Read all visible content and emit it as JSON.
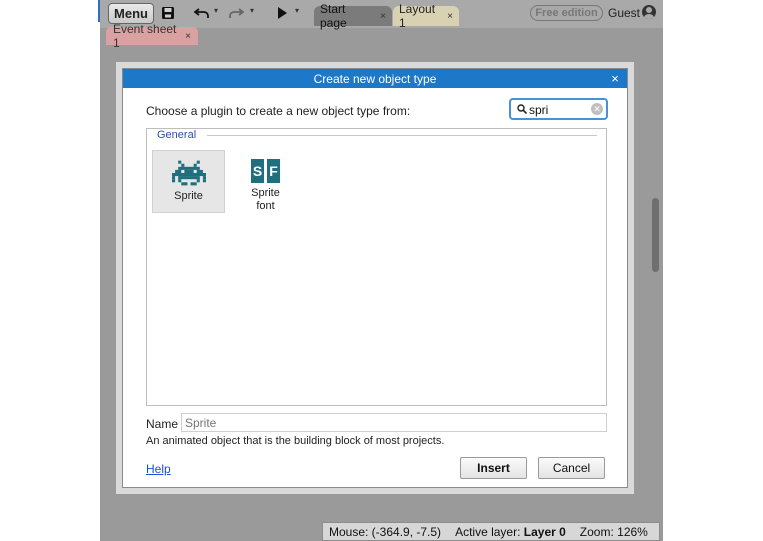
{
  "toolbar": {
    "menu_label": "Menu",
    "tabs": [
      {
        "label": "Start page",
        "close": "×"
      },
      {
        "label": "Layout 1",
        "close": "×"
      }
    ],
    "edition_badge": "Free edition",
    "user_label": "Guest"
  },
  "sheet_tab": {
    "label": "Event sheet 1",
    "close": "×"
  },
  "dialog": {
    "title": "Create new object type",
    "close": "×",
    "prompt": "Choose a plugin to create a new object type from:",
    "search": {
      "value": "spri"
    },
    "group": "General",
    "plugins": [
      {
        "label": "Sprite",
        "icon": "space-invader-icon",
        "selected": true
      },
      {
        "label": "Sprite font",
        "icon": "sprite-font-icon",
        "selected": false
      }
    ],
    "name_label": "Name",
    "name_placeholder": "Sprite",
    "description": "An animated object that is the building block of most projects.",
    "help_label": "Help",
    "insert_label": "Insert",
    "cancel_label": "Cancel"
  },
  "status": {
    "mouse": "Mouse: (-364.9, -7.5)",
    "active_layer_label": "Active layer:",
    "active_layer_value": "Layer 0",
    "zoom": "Zoom: 126%"
  },
  "colors": {
    "title_bar": "#1e78c8",
    "plugin_icon": "#1f6f7f",
    "link": "#1b4fd6",
    "search_focus": "#4a90d9"
  }
}
